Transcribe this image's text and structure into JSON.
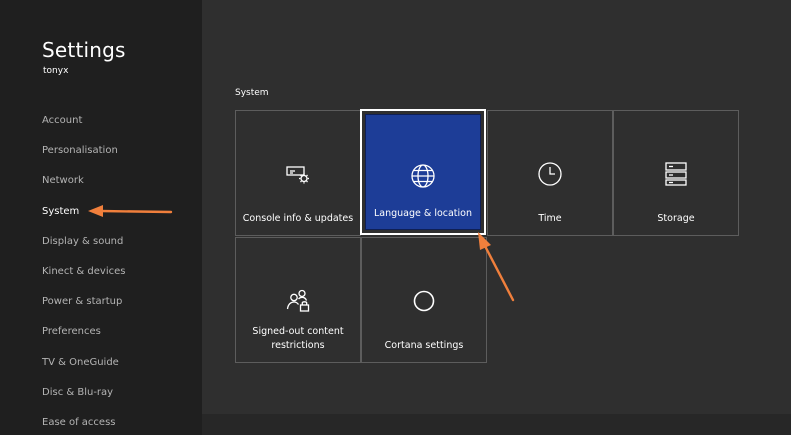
{
  "app": {
    "title": "Settings",
    "user": "tonyx"
  },
  "sidebar": {
    "items": [
      {
        "label": "Account",
        "active": false
      },
      {
        "label": "Personalisation",
        "active": false
      },
      {
        "label": "Network",
        "active": false
      },
      {
        "label": "System",
        "active": true
      },
      {
        "label": "Display & sound",
        "active": false
      },
      {
        "label": "Kinect & devices",
        "active": false
      },
      {
        "label": "Power & startup",
        "active": false
      },
      {
        "label": "Preferences",
        "active": false
      },
      {
        "label": "TV & OneGuide",
        "active": false
      },
      {
        "label": "Disc & Blu-ray",
        "active": false
      },
      {
        "label": "Ease of access",
        "active": false
      }
    ]
  },
  "main": {
    "section_label": "System",
    "tiles": [
      {
        "label": "Console info & updates",
        "icon": "console-info-icon",
        "focused": false
      },
      {
        "label": "Language & location",
        "icon": "globe-icon",
        "focused": true
      },
      {
        "label": "Time",
        "icon": "clock-icon",
        "focused": false
      },
      {
        "label": "Storage",
        "icon": "storage-icon",
        "focused": false
      },
      {
        "label": "Signed-out content restrictions",
        "icon": "users-lock-icon",
        "focused": false
      },
      {
        "label": "Cortana settings",
        "icon": "cortana-icon",
        "focused": false
      }
    ]
  },
  "colors": {
    "sidebar_bg": "#1f1f1f",
    "main_bg": "#2f2f2f",
    "tile_border": "#5d5d5d",
    "focus_fill": "#1d3d97",
    "annotation_arrow": "#f07f3c"
  }
}
